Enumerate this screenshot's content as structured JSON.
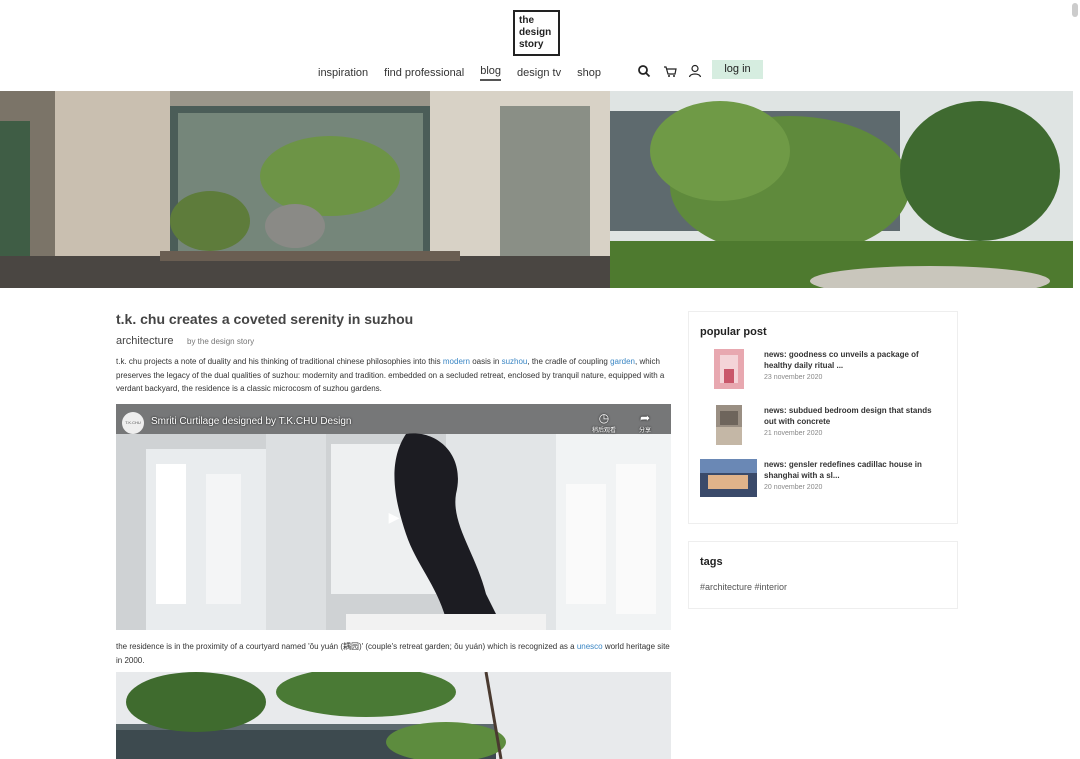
{
  "header": {
    "logo_lines": [
      "the",
      "design",
      "story"
    ],
    "nav": [
      {
        "label": "inspiration",
        "active": false
      },
      {
        "label": "find professional",
        "active": false
      },
      {
        "label": "blog",
        "active": true
      },
      {
        "label": "design tv",
        "active": false
      },
      {
        "label": "shop",
        "active": false
      }
    ],
    "icons": [
      "search-icon",
      "cart-icon",
      "user-icon"
    ],
    "login_label": "log in"
  },
  "article": {
    "title": "t.k. chu creates a coveted serenity in suzhou",
    "category": "architecture",
    "byline": "by the design story",
    "p1": {
      "a": "t.k. chu projects a note of duality and his thinking of traditional chinese philosophies into this ",
      "link1": "modern",
      "b": " oasis in ",
      "link2": "suzhou",
      "c": ", the cradle of coupling ",
      "link3": "garden",
      "d": ", which preserves the legacy of the dual qualities of suzhou: modernity and tradition. embedded on a secluded retreat, enclosed by tranquil nature, equipped with a verdant backyard, the residence is a classic microcosm of suzhou gardens."
    },
    "video": {
      "channel_logo": "T.K.CHU",
      "title": "Smriti Curtilage designed by T.K.CHU Design",
      "watch_later_label": "稍后观看",
      "share_label": "分享"
    },
    "p2": {
      "a": "the residence is in the proximity of a courtyard named 'ǒu yuán (耦园)' (couple's retreat garden; ǒu yuán) which is recognized as a ",
      "link1": "unesco",
      "b": " world heritage site in 2000."
    }
  },
  "sidebar": {
    "popular_title": "popular post",
    "posts": [
      {
        "title": "news: goodness co unveils a package of healthy daily ritual ...",
        "date": "23 november 2020"
      },
      {
        "title": "news: subdued bedroom design that stands out with concrete",
        "date": "21 november 2020"
      },
      {
        "title": "news: gensler redefines cadillac house in shanghai with a sl...",
        "date": "20 november 2020"
      }
    ],
    "tags_title": "tags",
    "tags": "#architecture #interior"
  },
  "colors": {
    "accent_link": "#3a86c4",
    "login_bg": "#d6ede0"
  }
}
